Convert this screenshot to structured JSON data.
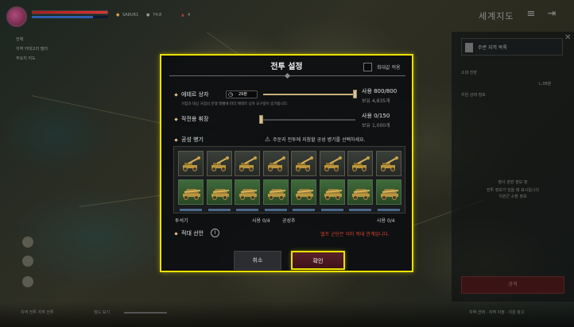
{
  "hud": {
    "player_name": "SA8UR1",
    "player_level": "74,8",
    "resource": "4",
    "region_title": "세계지도",
    "left_items": [
      "전체",
      "지역 카테고리 필터",
      "주요지 지도"
    ],
    "bottom_left": "지역 전투 지역 전투",
    "bottom_left2": "월드 보기",
    "bottom_right": "지역 선택 · 지역 지정 · 지원 창고"
  },
  "right_panel": {
    "title": "주변 지역 목록",
    "line1": "소대 전장",
    "line2": "L.08분",
    "line3": "지원 상태 정보",
    "center_title": "병사 관련 정보 창",
    "center_line1": "전투 정보가 있을 때 표시됩니다",
    "center_line2": "지원군 소환 정보",
    "button": "공격"
  },
  "modal": {
    "title": "전투 설정",
    "max_apply_label": "최대값 적용",
    "max_apply_checked": false,
    "aether": {
      "label": "에테르 상자",
      "timer": "29분",
      "note": "거점과 대상 거점의 분쟁 레벨에 따라 에테르 상자 요구량이 증가합니다.",
      "use": "사용 800/800",
      "own": "보유 4,835개",
      "fill_fraction": 1.0
    },
    "banner": {
      "label": "작전용 휘장",
      "use": "사용 0/150",
      "own": "보유 1,000개",
      "fill_fraction": 0.0
    },
    "siege": {
      "label": "공성 병기",
      "warning": "주둔지 전투에 지참할 공성 병기를 선택하세요."
    },
    "row_dark_count": 8,
    "row_green_count": 8,
    "catapult_label": "투석기",
    "catapult_use": "사용 0/4",
    "siege_tower_label": "공성추",
    "siege_tower_use": "사용 0/4",
    "hostile": {
      "label": "적대 선언",
      "info_glyph": "i",
      "notice": "엘프 군단은 이미 적대 관계입니다."
    },
    "cancel_label": "취소",
    "confirm_label": "확인"
  }
}
